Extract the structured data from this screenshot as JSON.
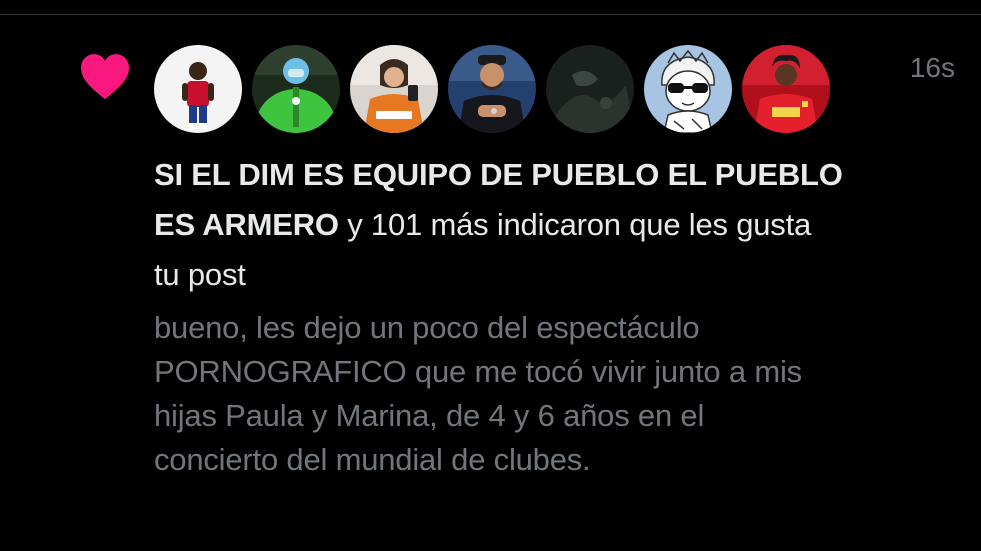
{
  "theme": {
    "background": "#000000",
    "text_primary": "#e7e9ea",
    "text_secondary": "#71767b",
    "heart_color": "#f91880"
  },
  "notification": {
    "icon": "heart-icon",
    "timestamp": "16s",
    "avatars": [
      {
        "name": "avatar-1",
        "desc": "person-red-jersey"
      },
      {
        "name": "avatar-2",
        "desc": "person-green-outfit"
      },
      {
        "name": "avatar-3",
        "desc": "person-orange-shirt"
      },
      {
        "name": "avatar-4",
        "desc": "person-dark-shirt"
      },
      {
        "name": "avatar-5",
        "desc": "dark-image"
      },
      {
        "name": "avatar-6",
        "desc": "cartoon-sunglasses"
      },
      {
        "name": "avatar-7",
        "desc": "person-red-jersey-2"
      }
    ],
    "headline": {
      "bold_lines": [
        "SI EL DIM ES EQUIPO DE PUEBLO EL PUEBLO",
        "ES ARMERO"
      ],
      "rest_line2": " y 101 más indicaron que les gusta",
      "rest_line3": "tu post"
    },
    "post_lines": [
      "bueno, les dejo un poco del espectáculo",
      "PORNOGRAFICO que me tocó vivir junto a mis",
      "hijas Paula y Marina, de 4 y 6 años en el",
      "concierto del mundial de clubes."
    ]
  }
}
